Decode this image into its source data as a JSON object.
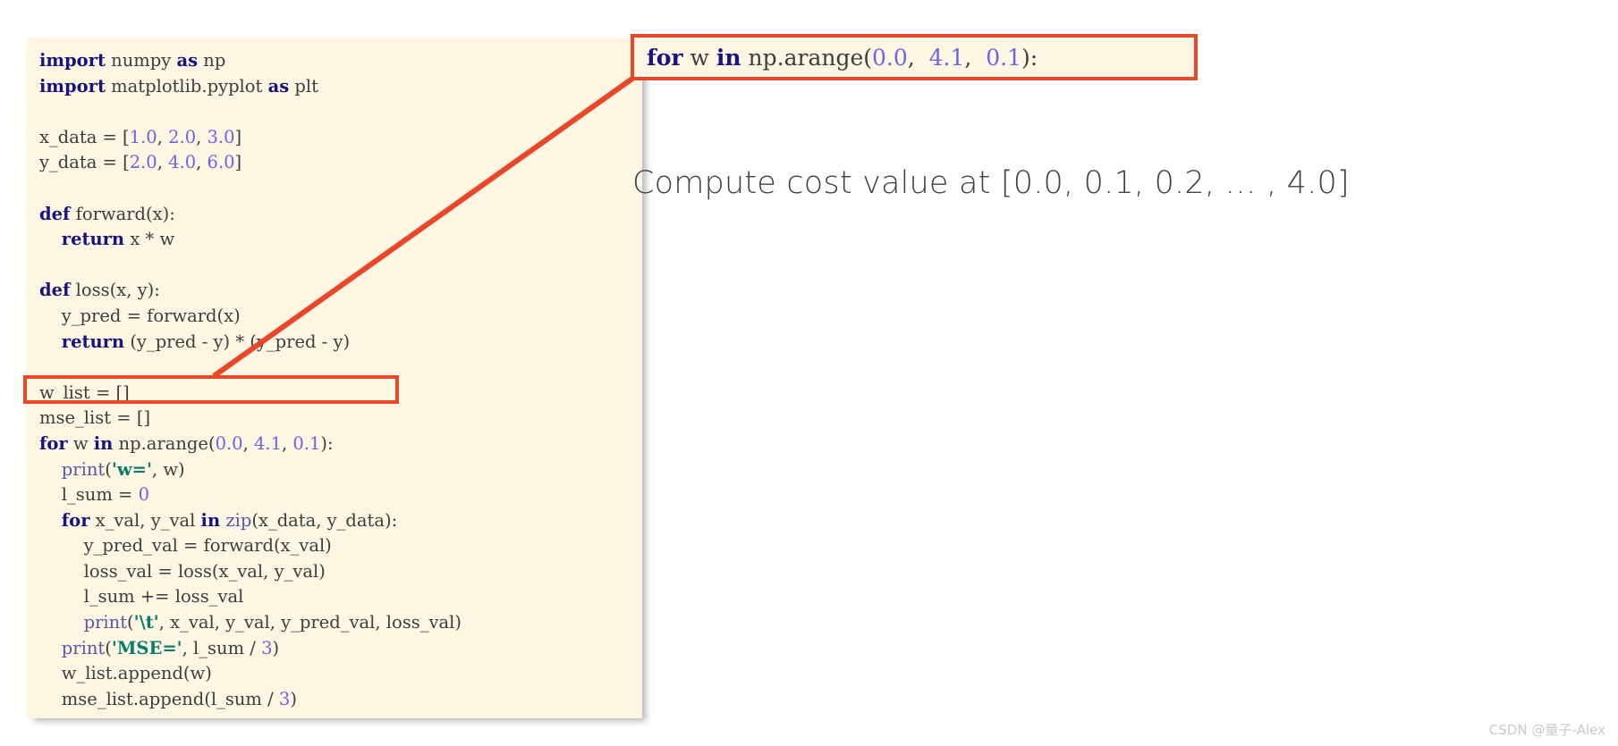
{
  "code_panel": {
    "background_color": "#fdf6e3",
    "lines": [
      [
        {
          "t": "import",
          "c": "kw"
        },
        {
          "t": " numpy ",
          "c": "name"
        },
        {
          "t": "as",
          "c": "kw"
        },
        {
          "t": " np",
          "c": "name"
        }
      ],
      [
        {
          "t": "import",
          "c": "kw"
        },
        {
          "t": " matplotlib.pyplot ",
          "c": "name"
        },
        {
          "t": "as",
          "c": "kw"
        },
        {
          "t": " plt",
          "c": "name"
        }
      ],
      [],
      [
        {
          "t": "x_data = [",
          "c": "name"
        },
        {
          "t": "1.0",
          "c": "num"
        },
        {
          "t": ", ",
          "c": "name"
        },
        {
          "t": "2.0",
          "c": "num"
        },
        {
          "t": ", ",
          "c": "name"
        },
        {
          "t": "3.0",
          "c": "num"
        },
        {
          "t": "]",
          "c": "name"
        }
      ],
      [
        {
          "t": "y_data = [",
          "c": "name"
        },
        {
          "t": "2.0",
          "c": "num"
        },
        {
          "t": ", ",
          "c": "name"
        },
        {
          "t": "4.0",
          "c": "num"
        },
        {
          "t": ", ",
          "c": "name"
        },
        {
          "t": "6.0",
          "c": "num"
        },
        {
          "t": "]",
          "c": "name"
        }
      ],
      [],
      [
        {
          "t": "def",
          "c": "kw"
        },
        {
          "t": " forward(x):",
          "c": "name"
        }
      ],
      [
        {
          "t": "    ",
          "c": "name"
        },
        {
          "t": "return",
          "c": "kw"
        },
        {
          "t": " x * w",
          "c": "name"
        }
      ],
      [],
      [
        {
          "t": "def",
          "c": "kw"
        },
        {
          "t": " loss(x, y):",
          "c": "name"
        }
      ],
      [
        {
          "t": "    y_pred = forward(x)",
          "c": "name"
        }
      ],
      [
        {
          "t": "    ",
          "c": "name"
        },
        {
          "t": "return",
          "c": "kw"
        },
        {
          "t": " (y_pred - y) * (y_pred - y)",
          "c": "name"
        }
      ],
      [],
      [
        {
          "t": "w_list = []",
          "c": "name"
        }
      ],
      [
        {
          "t": "mse_list = []",
          "c": "name"
        }
      ],
      [
        {
          "t": "for",
          "c": "kw"
        },
        {
          "t": " w ",
          "c": "name"
        },
        {
          "t": "in",
          "c": "kw"
        },
        {
          "t": " np.arange(",
          "c": "name"
        },
        {
          "t": "0.0",
          "c": "num"
        },
        {
          "t": ", ",
          "c": "name"
        },
        {
          "t": "4.1",
          "c": "num"
        },
        {
          "t": ", ",
          "c": "name"
        },
        {
          "t": "0.1",
          "c": "num"
        },
        {
          "t": "):",
          "c": "name"
        }
      ],
      [
        {
          "t": "    ",
          "c": "name"
        },
        {
          "t": "print",
          "c": "fn"
        },
        {
          "t": "(",
          "c": "name"
        },
        {
          "t": "'w='",
          "c": "str"
        },
        {
          "t": ", w)",
          "c": "name"
        }
      ],
      [
        {
          "t": "    l_sum = ",
          "c": "name"
        },
        {
          "t": "0",
          "c": "num"
        }
      ],
      [
        {
          "t": "    ",
          "c": "name"
        },
        {
          "t": "for",
          "c": "kw"
        },
        {
          "t": " x_val, y_val ",
          "c": "name"
        },
        {
          "t": "in",
          "c": "kw"
        },
        {
          "t": " ",
          "c": "name"
        },
        {
          "t": "zip",
          "c": "fn"
        },
        {
          "t": "(x_data, y_data):",
          "c": "name"
        }
      ],
      [
        {
          "t": "        y_pred_val = forward(x_val)",
          "c": "name"
        }
      ],
      [
        {
          "t": "        loss_val = loss(x_val, y_val)",
          "c": "name"
        }
      ],
      [
        {
          "t": "        l_sum += loss_val",
          "c": "name"
        }
      ],
      [
        {
          "t": "        ",
          "c": "name"
        },
        {
          "t": "print",
          "c": "fn"
        },
        {
          "t": "(",
          "c": "name"
        },
        {
          "t": "'\\t'",
          "c": "str"
        },
        {
          "t": ", x_val, y_val, y_pred_val, loss_val)",
          "c": "name"
        }
      ],
      [
        {
          "t": "    ",
          "c": "name"
        },
        {
          "t": "print",
          "c": "fn"
        },
        {
          "t": "(",
          "c": "name"
        },
        {
          "t": "'MSE='",
          "c": "str"
        },
        {
          "t": ", l_sum / ",
          "c": "name"
        },
        {
          "t": "3",
          "c": "num"
        },
        {
          "t": ")",
          "c": "name"
        }
      ],
      [
        {
          "t": "    w_list.append(w)",
          "c": "name"
        }
      ],
      [
        {
          "t": "    mse_list.append(l_sum / ",
          "c": "name"
        },
        {
          "t": "3",
          "c": "num"
        },
        {
          "t": ")",
          "c": "name"
        }
      ]
    ]
  },
  "highlight": {
    "border_color": "#e8472a",
    "highlighted_line_text": "for w in np.arange(0.0, 4.1, 0.1):"
  },
  "callout": {
    "border_color": "#e8472a",
    "background_color": "#fdf6e3",
    "segments": [
      {
        "t": "for",
        "c": "kw"
      },
      {
        "t": " w ",
        "c": "name"
      },
      {
        "t": "in",
        "c": "kw"
      },
      {
        "t": " np.arange(",
        "c": "name"
      },
      {
        "t": "0.0",
        "c": "num"
      },
      {
        "t": ",  ",
        "c": "name"
      },
      {
        "t": "4.1",
        "c": "num"
      },
      {
        "t": ",  ",
        "c": "name"
      },
      {
        "t": "0.1",
        "c": "num"
      },
      {
        "t": "):",
        "c": "name"
      }
    ],
    "plain_text": "for w in np.arange(0.0,  4.1,  0.1):"
  },
  "headline": {
    "text": "Compute cost value at [0.0, 0.1, 0.2, … , 4.0]",
    "color": "#3c4348"
  },
  "watermark": {
    "text": "CSDN @量子-Alex",
    "color": "#c9c9c9"
  },
  "connector": {
    "color": "#e8472a",
    "stroke_width": 6
  }
}
